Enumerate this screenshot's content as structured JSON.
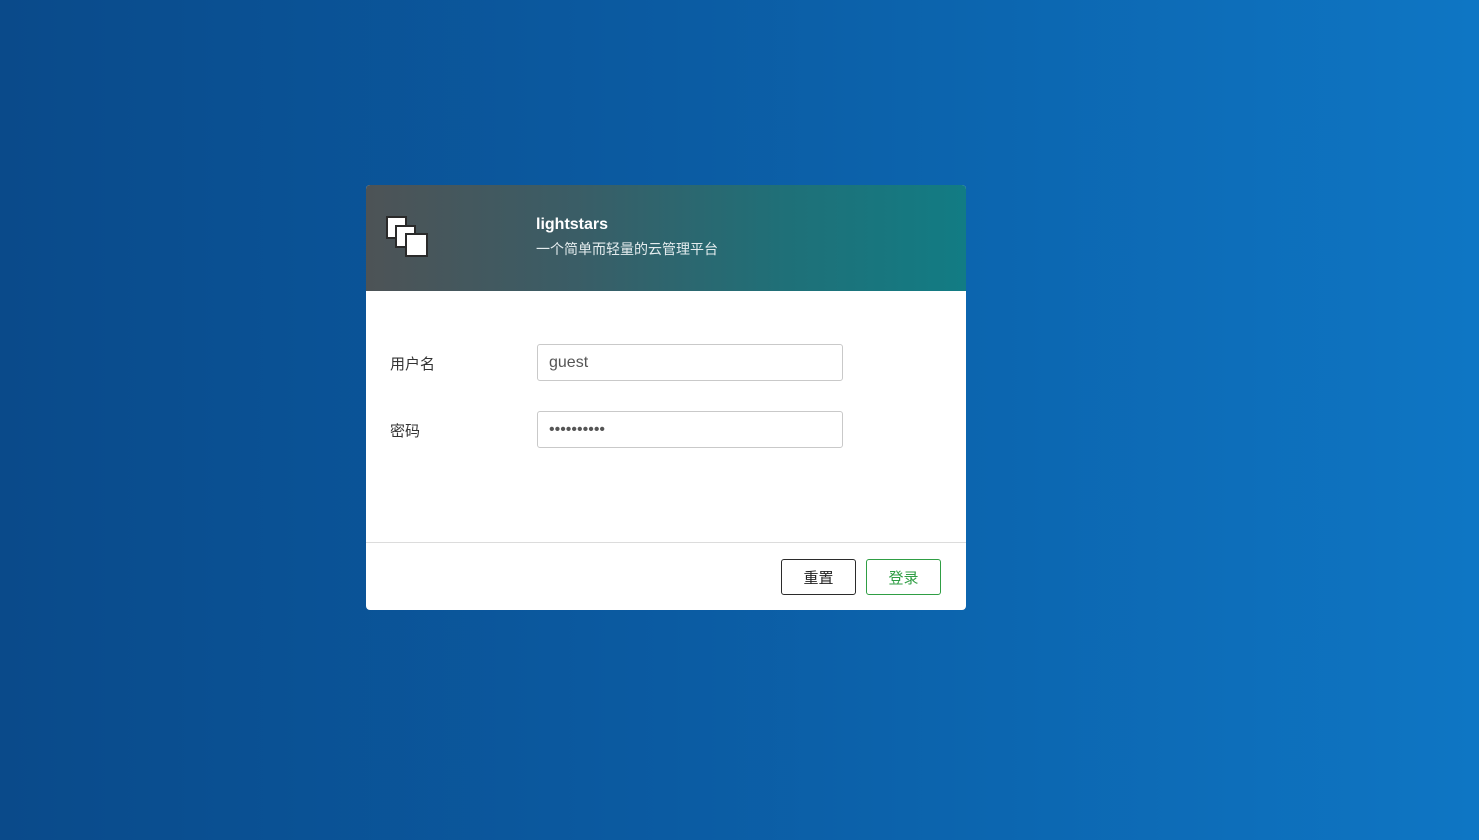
{
  "header": {
    "logo_icon": "stacked-windows-icon",
    "brand_name": "lightstars",
    "subtitle": "一个简单而轻量的云管理平台"
  },
  "form": {
    "username": {
      "label": "用户名",
      "value": "guest"
    },
    "password": {
      "label": "密码",
      "value": "••••••••••"
    }
  },
  "footer": {
    "reset_label": "重置",
    "login_label": "登录"
  },
  "colors": {
    "background_start": "#0a4a8a",
    "background_end": "#0e76c4",
    "header_start": "#4d5356",
    "header_end": "#127c84",
    "login_accent": "#2f9e44"
  }
}
